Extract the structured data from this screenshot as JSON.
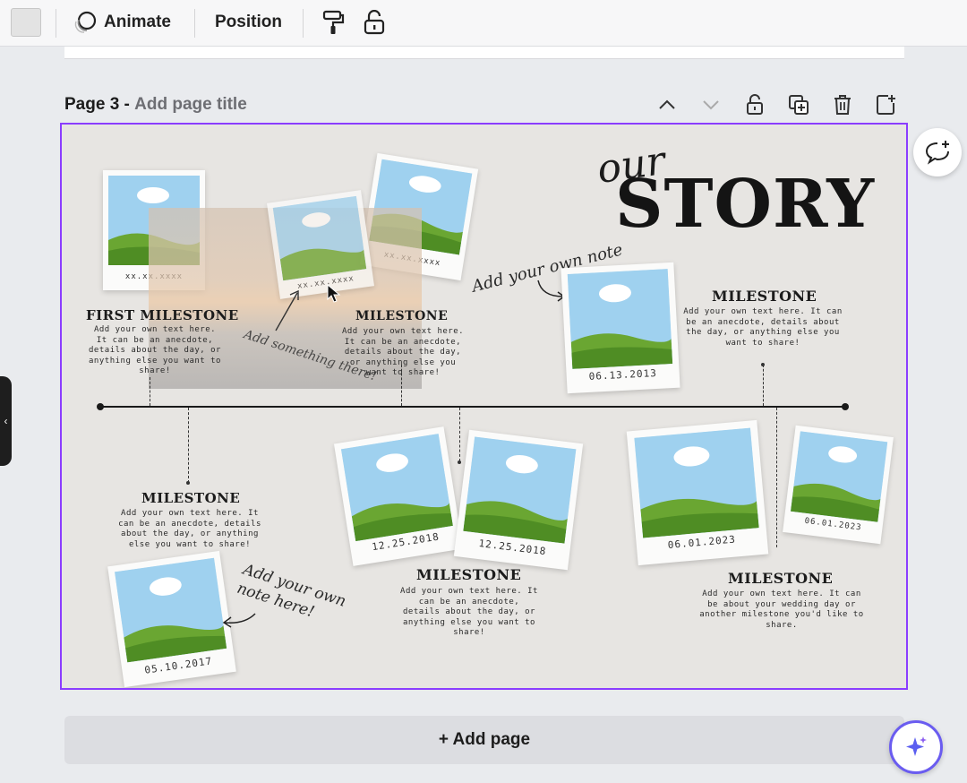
{
  "toolbar": {
    "animate_label": "Animate",
    "position_label": "Position",
    "icons": [
      "color-swatch",
      "animate-icon",
      "paint-roller-icon",
      "lock-icon"
    ]
  },
  "page": {
    "label": "Page 3 - ",
    "title_placeholder": "Add page title"
  },
  "design": {
    "heading_script": "our",
    "heading_main": "STORY",
    "milestones": [
      {
        "title": "FIRST MILESTONE",
        "body": "Add your own text here. It can be an anecdote, details about the day, or anything else you want to share!"
      },
      {
        "title": "MILESTONE",
        "body": "Add your own text here. It can be an anecdote, details about the day, or anything else you want to share!"
      },
      {
        "title": "MILESTONE",
        "body": "Add your own text here. It can be an anecdote, details about the day, or anything else you want to share!"
      },
      {
        "title": "MILESTONE",
        "body": "Add your own text here. It can be an anecdote, details about the day, or anything else you want to share!"
      },
      {
        "title": "MILESTONE",
        "body": "Add your own text here. It can be an anecdote, details about the day, or anything else you want to share!"
      },
      {
        "title": "MILESTONE",
        "body": "Add your own text here. It can be about your wedding day or another milestone you'd like to share."
      }
    ],
    "dates": [
      "xx.xx.xxxx",
      "xx.xx.xxxx",
      "xx.xx.xxxx",
      "06.13.2013",
      "12.25.2018",
      "12.25.2018",
      "06.01.2023",
      "06.01.2023",
      "05.10.2017"
    ],
    "notes": [
      "Add your own note",
      "Add something there!",
      "Add your own note here!"
    ]
  },
  "add_page_label": "+ Add page",
  "colors": {
    "selection": "#8b3dff",
    "canvas_bg": "#e7e5e2",
    "sky": "#9cd0ee",
    "grass": "#6aa632"
  }
}
